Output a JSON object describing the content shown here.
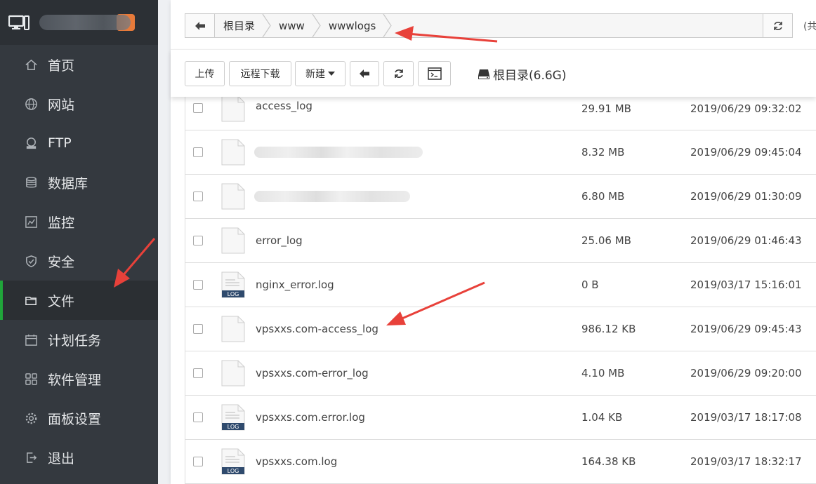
{
  "sidebar": {
    "items": [
      {
        "label": "首页",
        "icon": "home-icon"
      },
      {
        "label": "网站",
        "icon": "globe-icon"
      },
      {
        "label": "FTP",
        "icon": "ftp-icon"
      },
      {
        "label": "数据库",
        "icon": "database-icon"
      },
      {
        "label": "监控",
        "icon": "monitor-chart-icon"
      },
      {
        "label": "安全",
        "icon": "shield-icon"
      },
      {
        "label": "文件",
        "icon": "folder-icon",
        "active": true
      },
      {
        "label": "计划任务",
        "icon": "calendar-icon"
      },
      {
        "label": "软件管理",
        "icon": "apps-grid-icon"
      },
      {
        "label": "面板设置",
        "icon": "gear-icon"
      },
      {
        "label": "退出",
        "icon": "logout-icon"
      }
    ]
  },
  "pathbar": {
    "crumbs": [
      "根目录",
      "www",
      "wwwlogs"
    ],
    "extra": "(共"
  },
  "toolbar": {
    "upload": "上传",
    "remote_download": "远程下载",
    "new": "新建",
    "disk_label": "根目录(6.6G)"
  },
  "files": [
    {
      "name": "access_log",
      "size": "29.91 MB",
      "date": "2019/06/29 09:32:02",
      "icon": "file-icon"
    },
    {
      "name": "",
      "size": "8.32 MB",
      "date": "2019/06/29 09:45:04",
      "icon": "file-icon",
      "blurred": true
    },
    {
      "name": "",
      "size": "6.80 MB",
      "date": "2019/06/29 01:30:09",
      "icon": "file-icon",
      "blurred": true
    },
    {
      "name": "error_log",
      "size": "25.06 MB",
      "date": "2019/06/29 01:46:43",
      "icon": "file-icon"
    },
    {
      "name": "nginx_error.log",
      "size": "0 B",
      "date": "2019/03/17 15:16:01",
      "icon": "log-file-icon"
    },
    {
      "name": "vpsxxs.com-access_log",
      "size": "986.12 KB",
      "date": "2019/06/29 09:45:43",
      "icon": "file-icon"
    },
    {
      "name": "vpsxxs.com-error_log",
      "size": "4.10 MB",
      "date": "2019/06/29 09:20:00",
      "icon": "file-icon"
    },
    {
      "name": "vpsxxs.com.error.log",
      "size": "1.04 KB",
      "date": "2019/03/17 18:17:08",
      "icon": "log-file-icon"
    },
    {
      "name": "vpsxxs.com.log",
      "size": "164.38 KB",
      "date": "2019/03/17 18:32:17",
      "icon": "log-file-icon"
    }
  ],
  "log_badge": "LOG",
  "colors": {
    "sidebar_bg": "#34393f",
    "active_bar": "#20a53a",
    "arrow": "#e8413a"
  }
}
